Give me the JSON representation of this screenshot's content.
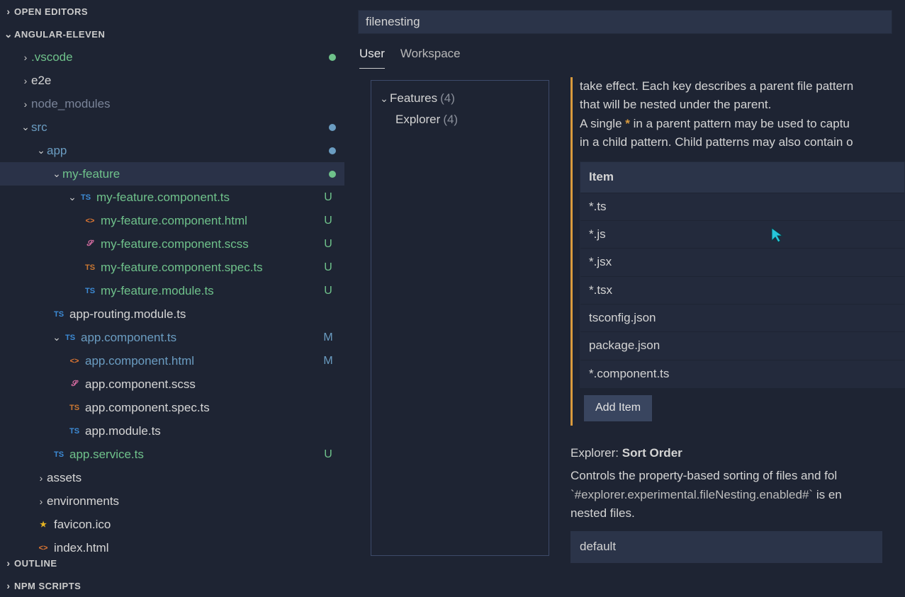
{
  "sidebar": {
    "panels": {
      "open_editors": "OPEN EDITORS",
      "project": "ANGULAR-ELEVEN",
      "outline": "OUTLINE",
      "npm_scripts": "NPM SCRIPTS"
    },
    "tree": [
      {
        "label": ".vscode",
        "indent": 1,
        "chev": "›",
        "color": "green",
        "dot": "green"
      },
      {
        "label": "e2e",
        "indent": 1,
        "chev": "›",
        "color": "white"
      },
      {
        "label": "node_modules",
        "indent": 1,
        "chev": "›",
        "color": "dim"
      },
      {
        "label": "src",
        "indent": 1,
        "chev": "⌄",
        "color": "lightblue",
        "dot": "blue"
      },
      {
        "label": "app",
        "indent": 2,
        "chev": "⌄",
        "color": "lightblue",
        "dot": "blue"
      },
      {
        "label": "my-feature",
        "indent": 3,
        "chev": "⌄",
        "color": "green",
        "dot": "green",
        "selected": true
      },
      {
        "label": "my-feature.component.ts",
        "indent": 4,
        "chev": "⌄",
        "icon": "TS",
        "iconcls": "ts-blue",
        "color": "green",
        "badge": "U"
      },
      {
        "label": "my-feature.component.html",
        "indent": 5,
        "icon": "<>",
        "iconcls": "html-orange",
        "color": "green",
        "badge": "U"
      },
      {
        "label": "my-feature.component.scss",
        "indent": 5,
        "icon": "𝓢",
        "iconcls": "scss-pink",
        "color": "green",
        "badge": "U"
      },
      {
        "label": "my-feature.component.spec.ts",
        "indent": 5,
        "icon": "TS",
        "iconcls": "ts-orange",
        "color": "green",
        "badge": "U"
      },
      {
        "label": "my-feature.module.ts",
        "indent": 5,
        "icon": "TS",
        "iconcls": "ts-blue",
        "color": "green",
        "badge": "U"
      },
      {
        "label": "app-routing.module.ts",
        "indent": 3,
        "icon": "TS",
        "iconcls": "ts-blue",
        "color": "white"
      },
      {
        "label": "app.component.ts",
        "indent": 3,
        "chev": "⌄",
        "icon": "TS",
        "iconcls": "ts-blue",
        "color": "lightblue",
        "badge": "M"
      },
      {
        "label": "app.component.html",
        "indent": 4,
        "icon": "<>",
        "iconcls": "html-orange",
        "color": "lightblue",
        "badge": "M"
      },
      {
        "label": "app.component.scss",
        "indent": 4,
        "icon": "𝓢",
        "iconcls": "scss-pink",
        "color": "white"
      },
      {
        "label": "app.component.spec.ts",
        "indent": 4,
        "icon": "TS",
        "iconcls": "ts-orange",
        "color": "white"
      },
      {
        "label": "app.module.ts",
        "indent": 4,
        "icon": "TS",
        "iconcls": "ts-blue",
        "color": "white"
      },
      {
        "label": "app.service.ts",
        "indent": 3,
        "icon": "TS",
        "iconcls": "ts-blue",
        "color": "green",
        "badge": "U"
      },
      {
        "label": "assets",
        "indent": 2,
        "chev": "›",
        "color": "white"
      },
      {
        "label": "environments",
        "indent": 2,
        "chev": "›",
        "color": "white"
      },
      {
        "label": "favicon.ico",
        "indent": 2,
        "icon": "★",
        "iconcls": "star",
        "color": "white"
      },
      {
        "label": "index.html",
        "indent": 2,
        "icon": "<>",
        "iconcls": "html-orange",
        "color": "white"
      }
    ]
  },
  "settings": {
    "search_value": "filenesting",
    "tabs": {
      "user": "User",
      "workspace": "Workspace"
    },
    "toc": {
      "features": {
        "label": "Features",
        "count": "(4)"
      },
      "explorer": {
        "label": "Explorer",
        "count": "(4)"
      }
    },
    "patterns": {
      "desc_line1": "take effect. Each key describes a parent file pattern",
      "desc_line2": "that will be nested under the parent.",
      "desc_line3a": "A single ",
      "desc_line3b": " in a parent pattern may be used to captu",
      "desc_line4": "in a child pattern. Child patterns may also contain o",
      "header": "Item",
      "items": [
        "*.ts",
        "*.js",
        "*.jsx",
        "*.tsx",
        "tsconfig.json",
        "package.json",
        "*.component.ts"
      ],
      "add_button": "Add Item"
    },
    "sort_order": {
      "prefix": "Explorer: ",
      "name": "Sort Order",
      "desc1": "Controls the property-based sorting of files and fol",
      "desc2a": "`#explorer.experimental.fileNesting.enabled#`",
      "desc2b": " is en",
      "desc3": "nested files.",
      "value": "default"
    }
  }
}
